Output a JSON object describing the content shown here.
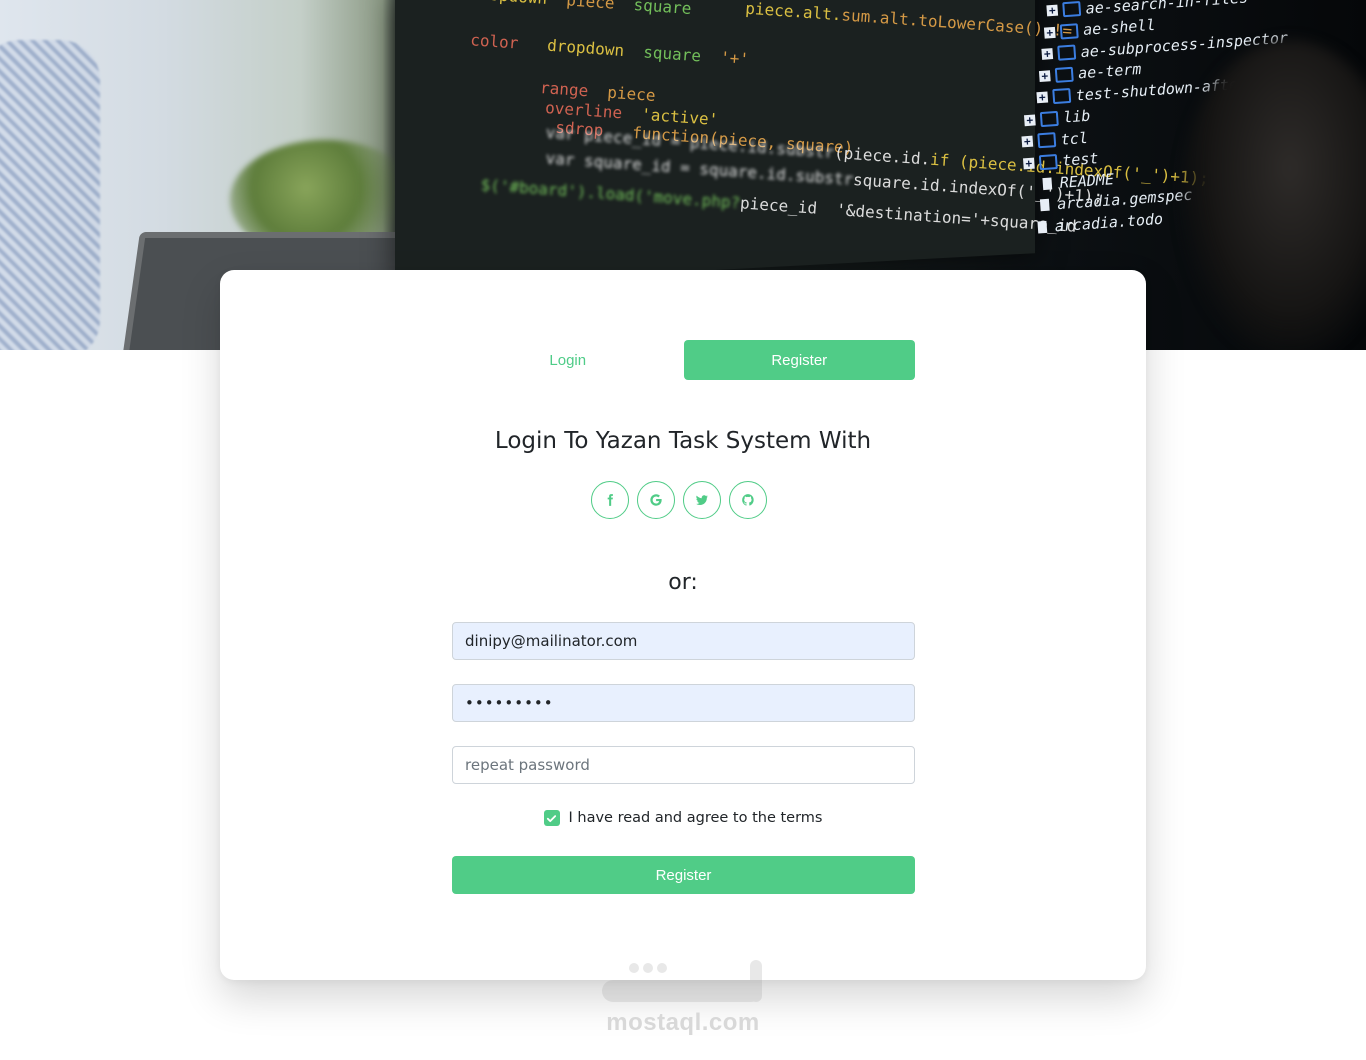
{
  "hero": {
    "code_lines": [
      "sum.alt.toLowerCase() !=",
      "if (piece.id.indexOf('_')+1);",
      "square.id.indexOf('_')+1);",
      "piece_id  '&destination='+square_id"
    ],
    "file_tree": [
      {
        "type": "folder",
        "name": "ae-search-in-files"
      },
      {
        "type": "folder",
        "name": "ae-shell"
      },
      {
        "type": "folder",
        "name": "ae-subprocess-inspector"
      },
      {
        "type": "folder",
        "name": "ae-term"
      },
      {
        "type": "folder",
        "name": "test-shutdown-after-startup"
      },
      {
        "type": "folder",
        "name": "lib"
      },
      {
        "type": "folder",
        "name": "tcl"
      },
      {
        "type": "folder",
        "name": "test"
      },
      {
        "type": "file",
        "name": "README"
      },
      {
        "type": "file",
        "name": "arcadia.gemspec"
      },
      {
        "type": "file",
        "name": "arcadia.todo"
      }
    ]
  },
  "tabs": {
    "login_label": "Login",
    "register_label": "Register",
    "active": "Register"
  },
  "heading": "Login To Yazan Task System With",
  "socials": [
    {
      "icon": "facebook-icon"
    },
    {
      "icon": "google-icon"
    },
    {
      "icon": "twitter-icon"
    },
    {
      "icon": "github-icon"
    }
  ],
  "or_text": "or:",
  "form": {
    "email_value": "dinipy@mailinator.com",
    "password_value": "•••••••••",
    "repeat_placeholder": "repeat password",
    "repeat_value": "",
    "terms_label": "I have read and agree to the terms",
    "terms_checked": true,
    "submit_label": "Register"
  },
  "watermark": {
    "text": "mostaql.com"
  },
  "colors": {
    "accent": "#50cc87",
    "autofill": "#e8f0fe",
    "text": "#212529"
  }
}
